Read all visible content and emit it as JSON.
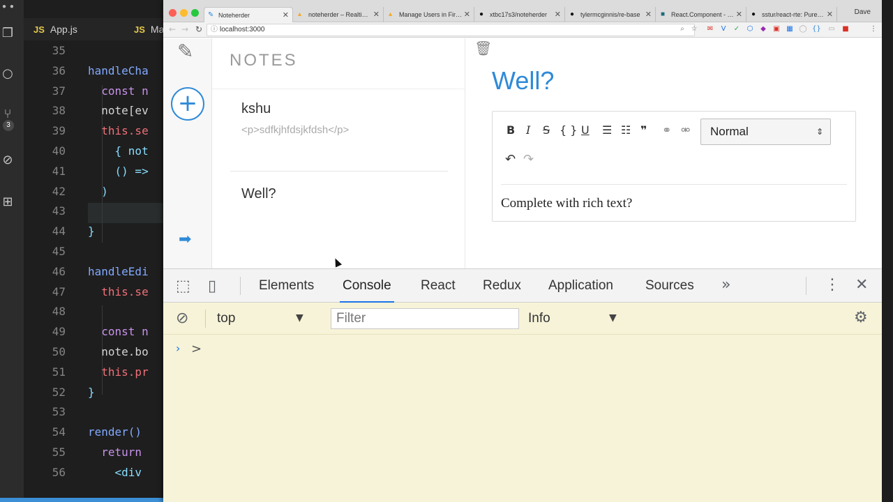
{
  "editor": {
    "tabs": [
      {
        "badge": "JS",
        "label": "App.js"
      },
      {
        "badge": "JS",
        "label": "Ma"
      }
    ],
    "source_control_count": "3",
    "line_numbers": [
      "35",
      "36",
      "37",
      "38",
      "39",
      "40",
      "41",
      "42",
      "43",
      "44",
      "45",
      "46",
      "47",
      "48",
      "49",
      "50",
      "51",
      "52",
      "53",
      "54",
      "55",
      "56"
    ],
    "code": [
      "",
      "handleCha",
      "  const n",
      "  note[ev",
      "  this.se",
      "    { not",
      "    () =>",
      "  )",
      "",
      "}",
      "",
      "handleEdi",
      "  this.se",
      "",
      "  const n",
      "  note.bo",
      "  this.pr",
      "}",
      "",
      "render() ",
      "  return",
      "    <div"
    ]
  },
  "browser": {
    "tabs": [
      {
        "icon": "pencil-favicon",
        "label": "Noteherder"
      },
      {
        "icon": "firebase-favicon",
        "label": "noteherder – Realtime D"
      },
      {
        "icon": "firebase-favicon",
        "label": "Manage Users in Fireba"
      },
      {
        "icon": "github-favicon",
        "label": "xtbc17s3/noteherder"
      },
      {
        "icon": "github-favicon",
        "label": "tylermcginnis/re-base"
      },
      {
        "icon": "react-favicon",
        "label": "React.Component - Re"
      },
      {
        "icon": "github-favicon",
        "label": "sstur/react-rte: Pure Re"
      }
    ],
    "profile_name": "Dave",
    "url": "localhost:3000"
  },
  "app": {
    "notes_heading": "NOTES",
    "notes": [
      {
        "title": "kshu",
        "body": "<p>sdfkjhfdsjkfdsh</p>"
      },
      {
        "title": "Well?",
        "body": ""
      }
    ],
    "current_note": {
      "title": "Well?",
      "body": "Complete with rich text?"
    },
    "editor_toolbar": {
      "buttons": [
        "B",
        "I",
        "S",
        "{ }",
        "U",
        "bulleted-list",
        "numbered-list",
        "blockquote",
        "link",
        "unlink"
      ],
      "block_type": "Normal"
    }
  },
  "devtools": {
    "tabs": [
      "Elements",
      "Console",
      "React",
      "Redux",
      "Application",
      "Sources"
    ],
    "active_tab": "Console",
    "context": "top",
    "filter_placeholder": "Filter",
    "level": "Info"
  }
}
